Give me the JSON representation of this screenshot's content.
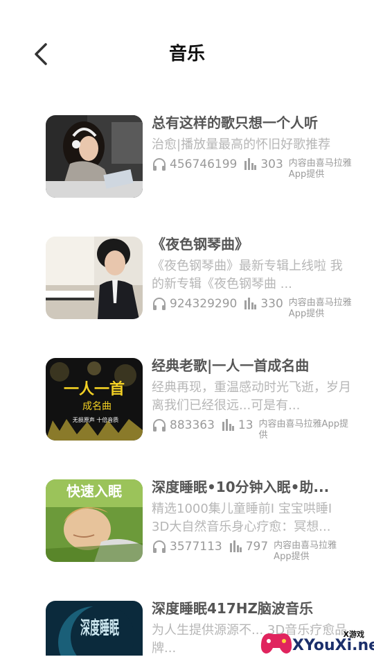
{
  "header": {
    "title": "音乐"
  },
  "items": [
    {
      "title": "总有这样的歌只想一个人听",
      "desc": "治愈|播放量最高的怀旧好歌推荐",
      "plays": "456746199",
      "tracks": "303",
      "source": "内容由喜马拉雅App提供"
    },
    {
      "title": "《夜色钢琴曲》",
      "desc": "《夜色钢琴曲》最新专辑上线啦 我的新专辑《夜色钢琴曲 ...",
      "plays": "924329290",
      "tracks": "330",
      "source": "内容由喜马拉雅App提供"
    },
    {
      "title": "经典老歌|一人一首成名曲",
      "desc": "经典再现，重温感动时光飞逝，岁月离我们已经很远...可是有...",
      "plays": "883363",
      "tracks": "13",
      "source": "内容由喜马拉雅App提供",
      "thumb_text": {
        "main": "一人一首",
        "sub": "成名曲",
        "small": "无损原声 十倍音质"
      }
    },
    {
      "title": "深度睡眠•10分钟入眠•助...",
      "desc": "精选1000集儿童睡前I 宝宝哄睡I 3D大自然音乐身心疗愈：冥想...",
      "plays": "3577113",
      "tracks": "797",
      "source": "内容由喜马拉雅App提供",
      "thumb_text": {
        "main": "快速入眠"
      }
    },
    {
      "title": "深度睡眠417HZ脑波音乐",
      "desc": "为人生提供源源不... 3D音乐疗愈品牌...",
      "thumb_text": {
        "main": "深度睡眠"
      }
    }
  ],
  "watermark": {
    "brand": "XYouXi.net",
    "small": "X游戏"
  },
  "colors": {
    "title": "#555555",
    "desc": "#b6b6b6",
    "meta": "#9a9a9a"
  }
}
